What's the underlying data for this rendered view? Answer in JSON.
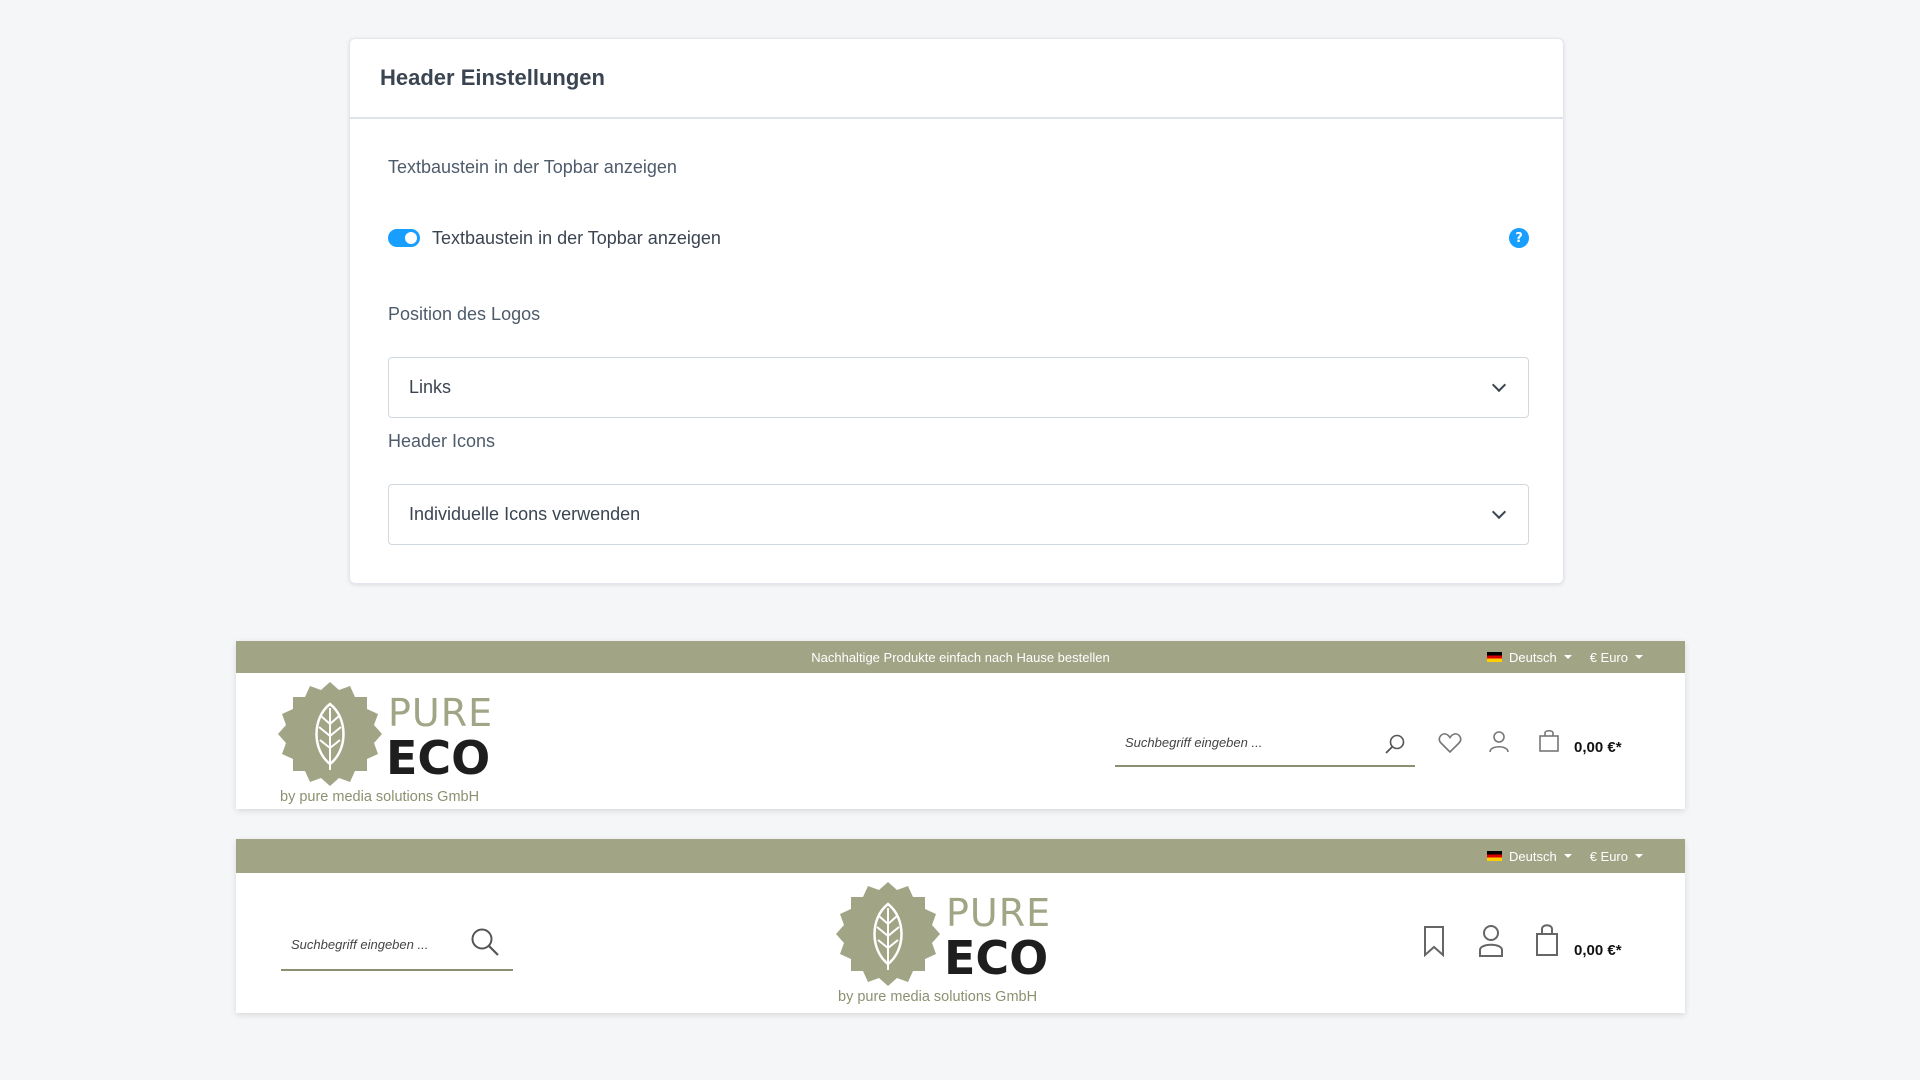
{
  "settings": {
    "title": "Header Einstellungen",
    "section_label": "Textbaustein in der Topbar anzeigen",
    "toggle_label": "Textbaustein in der Topbar anzeigen",
    "toggle_on": true,
    "help_glyph": "?",
    "logo_position": {
      "label": "Position des Logos",
      "value": "Links"
    },
    "header_icons": {
      "label": "Header Icons",
      "value": "Individuelle Icons verwenden"
    },
    "accent_color": "#189eff"
  },
  "preview_left": {
    "topbar_text": "Nachhaltige Produkte einfach nach Hause bestellen",
    "language": "Deutsch",
    "currency": "€ Euro",
    "logo": {
      "word1": "PURE",
      "word2": "ECO",
      "tagline": "by pure media solutions GmbH"
    },
    "search_placeholder": "Suchbegriff eingeben ...",
    "icons": [
      "search-icon",
      "heart-icon",
      "user-icon",
      "bag-icon"
    ],
    "cart_total": "0,00 €*"
  },
  "preview_center": {
    "language": "Deutsch",
    "currency": "€ Euro",
    "logo": {
      "word1": "PURE",
      "word2": "ECO",
      "tagline": "by pure media solutions GmbH"
    },
    "search_placeholder": "Suchbegriff eingeben ...",
    "icons": [
      "search-icon",
      "bookmark-icon",
      "user-icon",
      "bag-icon"
    ],
    "cart_total": "0,00 €*"
  },
  "colors": {
    "topbar": "#a1a585",
    "logo_olive": "#a1a585",
    "logo_dark": "#1e1e1e"
  }
}
